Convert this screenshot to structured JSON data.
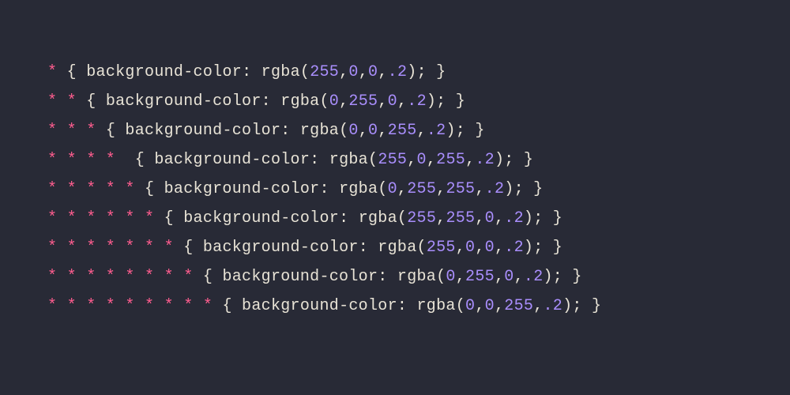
{
  "code": {
    "lines": [
      {
        "selector": "*",
        "property": "background-color",
        "func": "rgba",
        "args": [
          "255",
          "0",
          "0",
          ".2"
        ]
      },
      {
        "selector": "* *",
        "property": "background-color",
        "func": "rgba",
        "args": [
          "0",
          "255",
          "0",
          ".2"
        ]
      },
      {
        "selector": "* * *",
        "property": "background-color",
        "func": "rgba",
        "args": [
          "0",
          "0",
          "255",
          ".2"
        ]
      },
      {
        "selector": "* * * * ",
        "property": "background-color",
        "func": "rgba",
        "args": [
          "255",
          "0",
          "255",
          ".2"
        ]
      },
      {
        "selector": "* * * * *",
        "property": "background-color",
        "func": "rgba",
        "args": [
          "0",
          "255",
          "255",
          ".2"
        ]
      },
      {
        "selector": "* * * * * *",
        "property": "background-color",
        "func": "rgba",
        "args": [
          "255",
          "255",
          "0",
          ".2"
        ]
      },
      {
        "selector": "* * * * * * *",
        "property": "background-color",
        "func": "rgba",
        "args": [
          "255",
          "0",
          "0",
          ".2"
        ]
      },
      {
        "selector": "* * * * * * * *",
        "property": "background-color",
        "func": "rgba",
        "args": [
          "0",
          "255",
          "0",
          ".2"
        ]
      },
      {
        "selector": "* * * * * * * * *",
        "property": "background-color",
        "func": "rgba",
        "args": [
          "0",
          "0",
          "255",
          ".2"
        ]
      }
    ]
  }
}
